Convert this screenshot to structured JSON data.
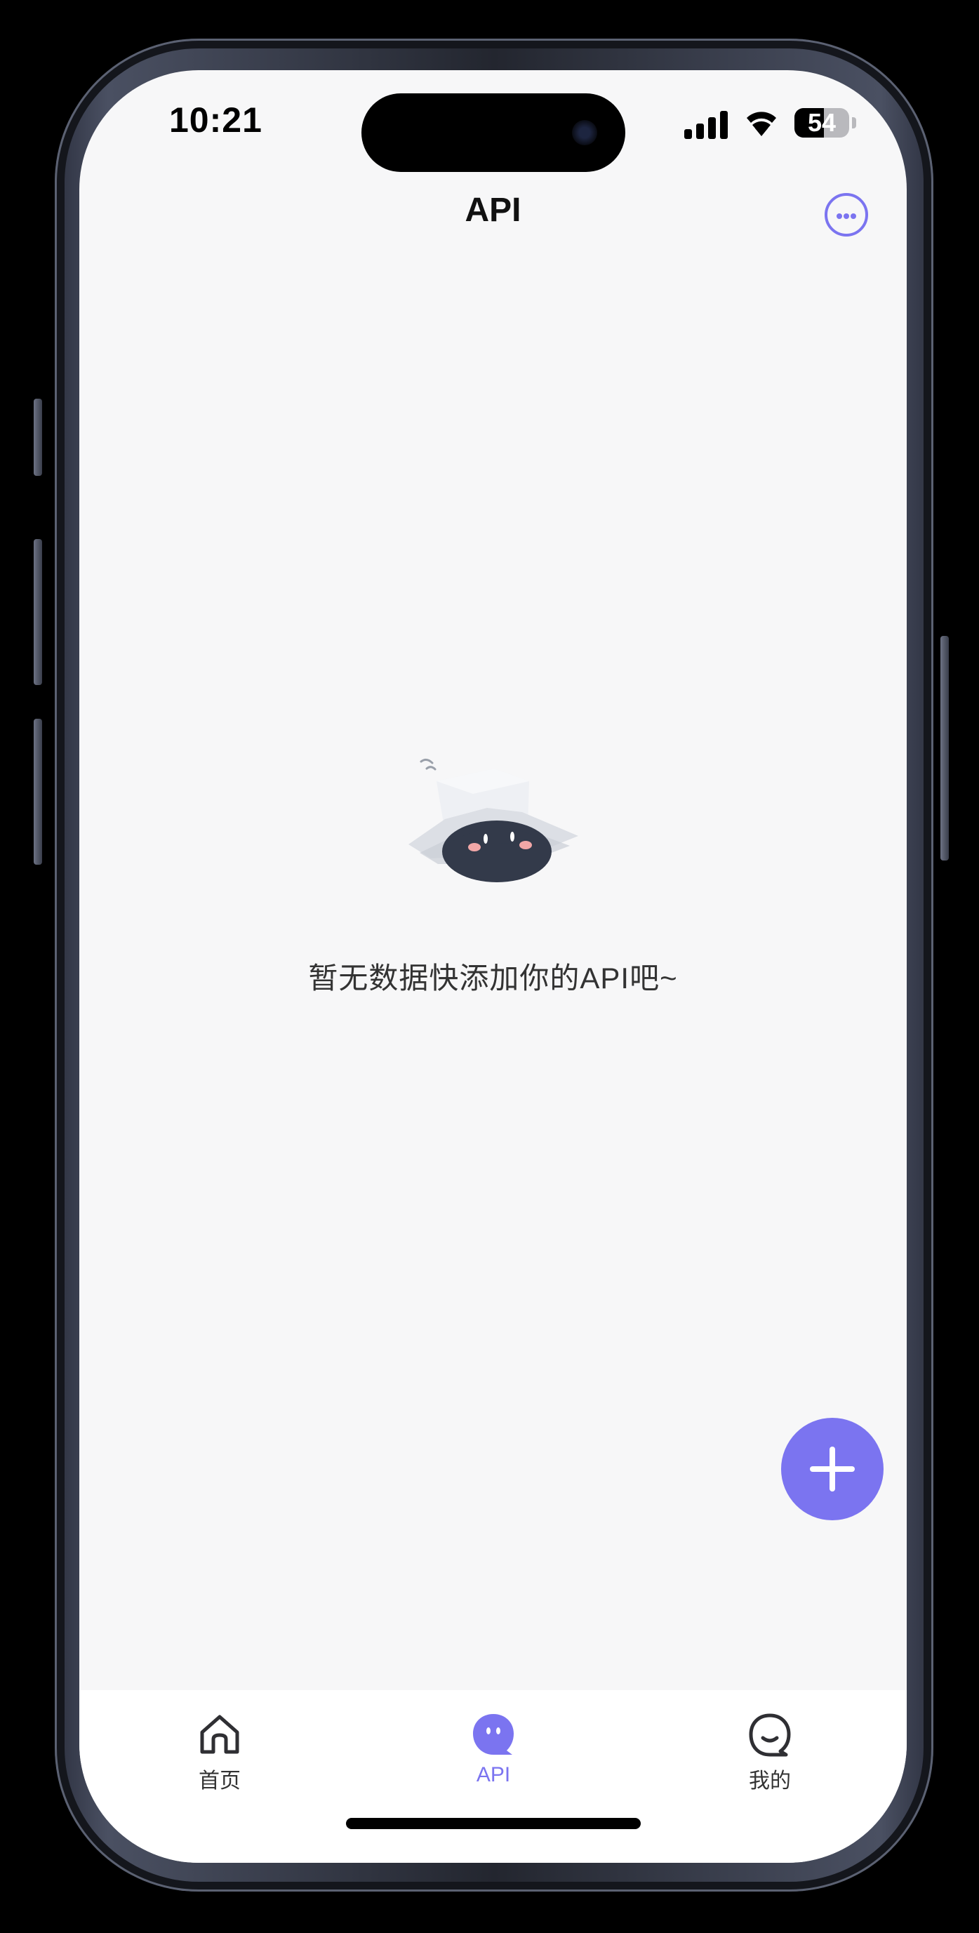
{
  "status_bar": {
    "time": "10:21",
    "battery_level": 54,
    "battery_label": "54",
    "signal_icon": "cellular-signal-icon",
    "wifi_icon": "wifi-icon"
  },
  "header": {
    "title": "API",
    "more_icon": "more-horizontal-icon"
  },
  "empty_state": {
    "illustration": "empty-box-creature-illustration",
    "message": "暂无数据快添加你的API吧~"
  },
  "fab": {
    "icon": "plus-icon"
  },
  "tab_bar": {
    "active": "api",
    "tabs": [
      {
        "id": "home",
        "label": "首页",
        "icon": "house-icon"
      },
      {
        "id": "api",
        "label": "API",
        "icon": "chat-bubble-icon"
      },
      {
        "id": "mine",
        "label": "我的",
        "icon": "smiley-face-icon"
      }
    ]
  },
  "colors": {
    "accent": "#7b74f0",
    "background": "#f7f7f8",
    "tab_bar": "#ffffff",
    "text": "#333333"
  }
}
